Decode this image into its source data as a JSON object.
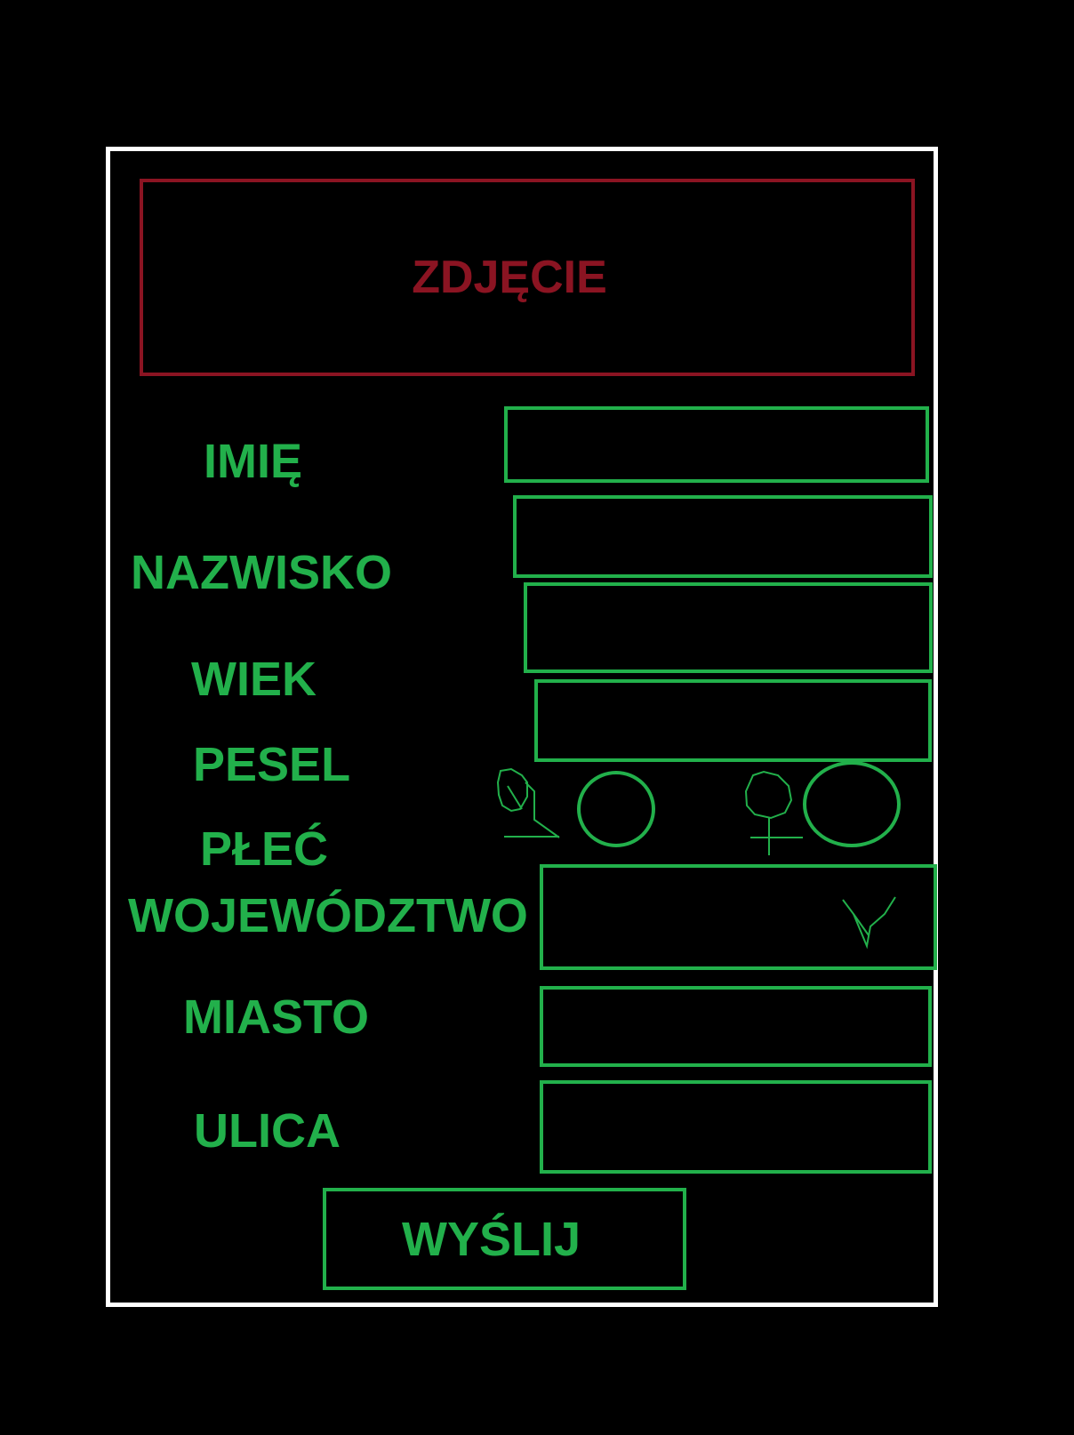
{
  "photo": {
    "label": "ZDJĘCIE"
  },
  "form": {
    "fields": {
      "first_name": {
        "label": "IMIĘ",
        "value": ""
      },
      "last_name": {
        "label": "NAZWISKO",
        "value": ""
      },
      "age": {
        "label": "WIEK",
        "value": ""
      },
      "pesel": {
        "label": "PESEL",
        "value": ""
      },
      "gender": {
        "label": "PŁEĆ",
        "options": [
          "male-symbol-icon",
          "female-symbol-icon"
        ]
      },
      "voivodeship": {
        "label": "WOJEWÓDZTWO",
        "value": ""
      },
      "city": {
        "label": "MIASTO",
        "value": ""
      },
      "street": {
        "label": "ULICA",
        "value": ""
      }
    },
    "submit_label": "WYŚLIJ"
  },
  "colors": {
    "background": "#000000",
    "frame": "#ffffff",
    "photo_accent": "#8b1422",
    "form_accent": "#22b04b"
  }
}
